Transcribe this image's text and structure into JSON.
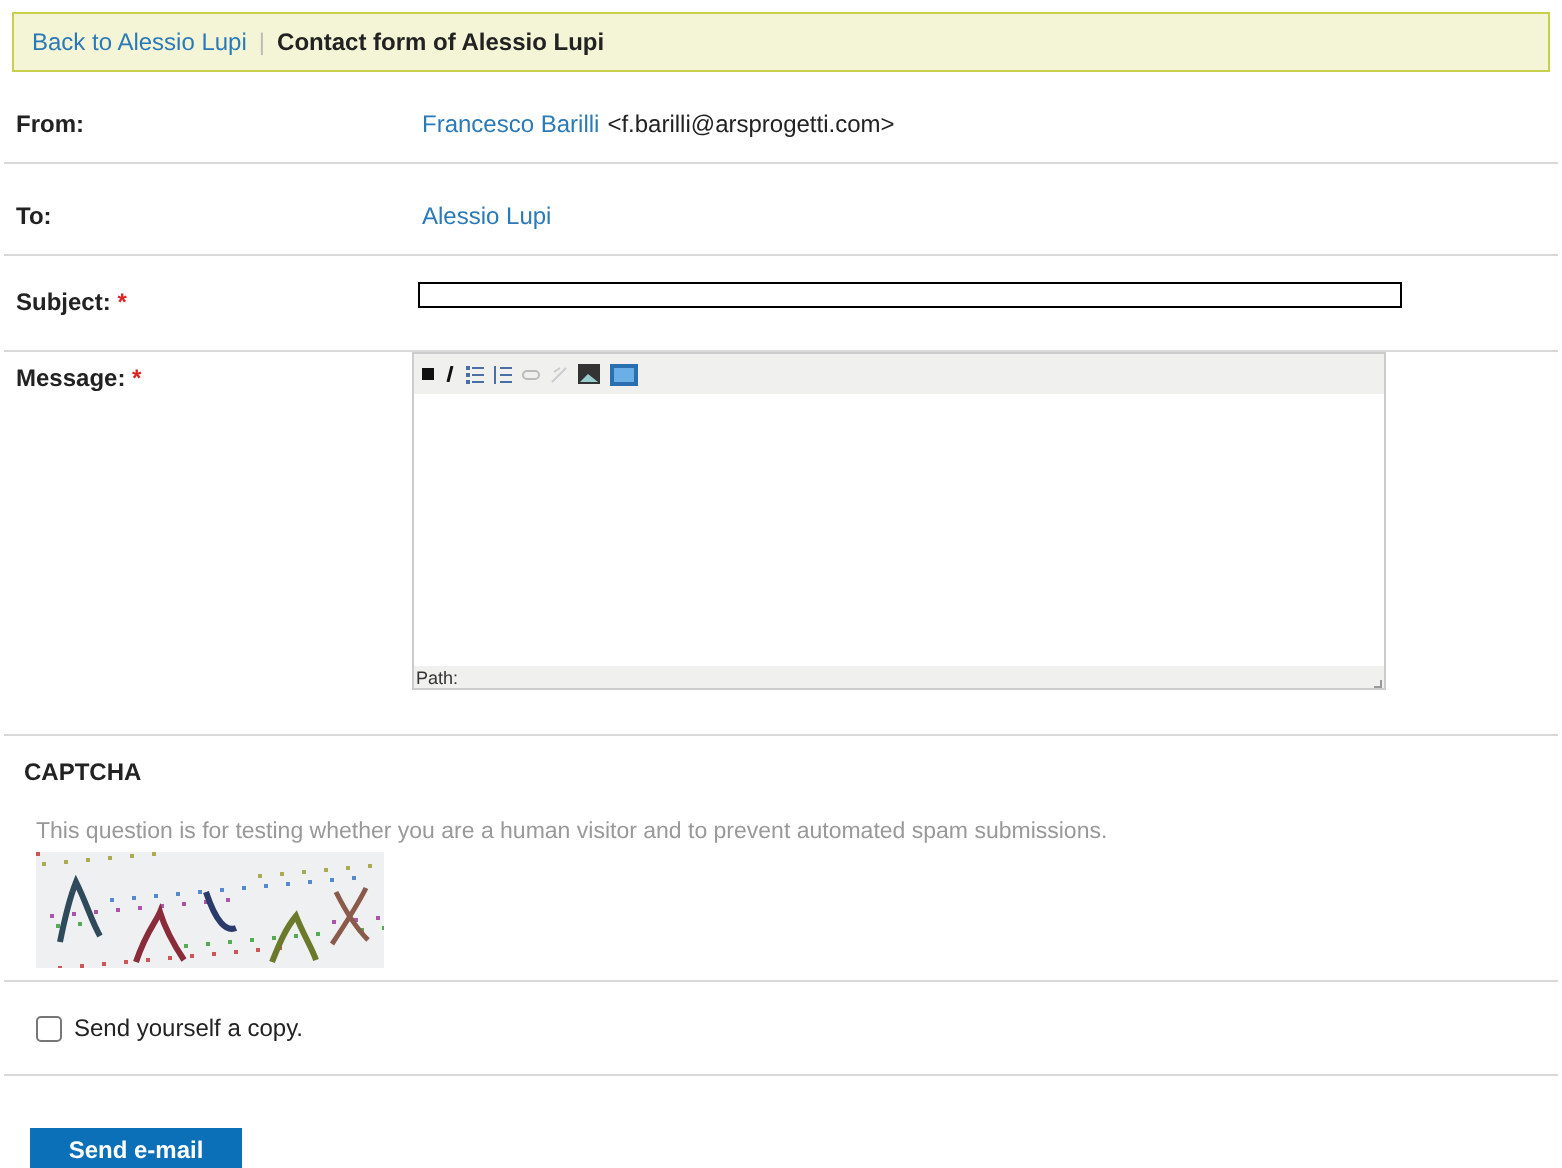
{
  "breadcrumb": {
    "back_link": "Back to Alessio Lupi",
    "separator": "|",
    "title": "Contact form of Alessio Lupi"
  },
  "fields": [
    {
      "kind": "text",
      "label": "From:",
      "link": "Francesco Barilli",
      "extra": "<f.barilli@arsprogetti.com>"
    },
    {
      "kind": "text",
      "label": "To:",
      "link": "Alessio Lupi"
    },
    {
      "kind": "input",
      "label": "Subject:",
      "required_mark": "*"
    },
    {
      "kind": "editor",
      "label": "Message:",
      "required_mark": "*",
      "status": "Path:"
    }
  ],
  "captcha": {
    "title": "CAPTCHA",
    "description": "This question is for testing whether you are a human visitor and to prevent automated spam submissions."
  },
  "copy_option": {
    "label": "Send yourself a copy.",
    "checked": false
  },
  "submit": "Send e-mail"
}
